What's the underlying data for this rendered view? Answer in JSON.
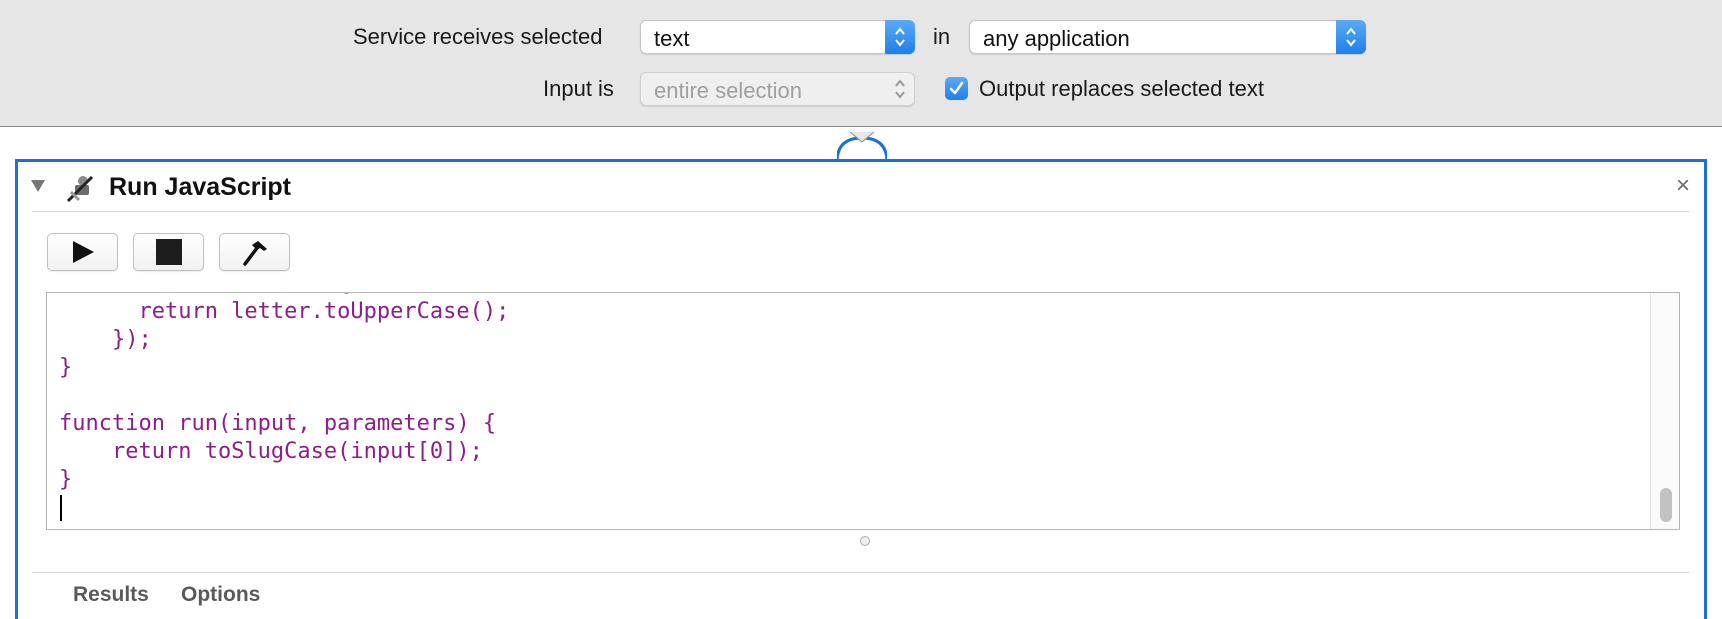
{
  "service": {
    "receives_label": "Service receives selected",
    "receives_value": "text",
    "in_label": "in",
    "application_value": "any application",
    "input_label": "Input is",
    "input_value": "entire selection",
    "output_checkbox_label": "Output replaces selected text",
    "output_checkbox_checked": true
  },
  "action": {
    "title": "Run JavaScript",
    "close_symbol": "×",
    "toolbar": {
      "run_icon": "play-icon",
      "stop_icon": "stop-icon",
      "compile_icon": "hammer-icon"
    },
    "code": "      letter, index) {\n      return letter.toUpperCase();\n    });\n}\n\nfunction run(input, parameters) {\n    return toSlugCase(input[0]);\n}\n",
    "footer_tabs": [
      "Results",
      "Options"
    ]
  },
  "colors": {
    "accent": "#1b6fd6",
    "code_text": "#8c1e8a",
    "top_bar_bg": "#e6e6e6"
  }
}
